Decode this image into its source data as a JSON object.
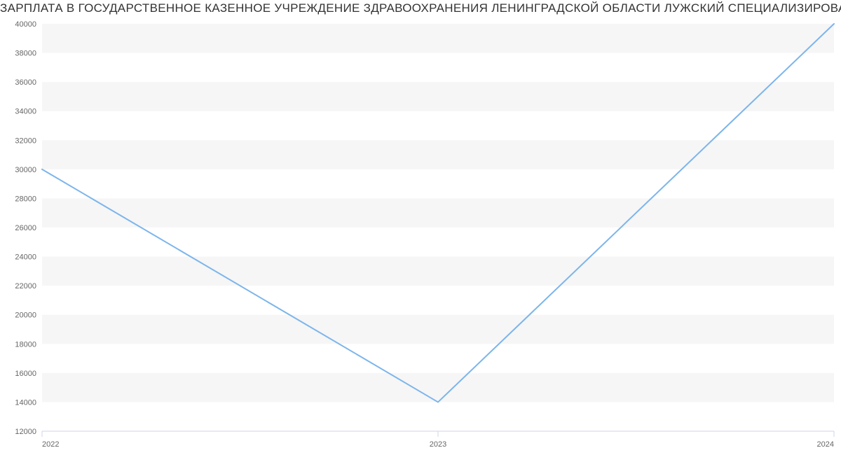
{
  "title": "ЗАРПЛАТА В ГОСУДАРСТВЕННОЕ КАЗЕННОЕ УЧРЕЖДЕНИЕ ЗДРАВООХРАНЕНИЯ ЛЕНИНГРАДСКОЙ ОБЛАСТИ  ЛУЖСКИЙ СПЕЦИАЛИЗИРОВАННЫЙ ДОМ РЕБЕНКА | Данные mnogodetey.ru",
  "chart_data": {
    "type": "line",
    "x": [
      2022,
      2023,
      2024
    ],
    "values": [
      30000,
      14000,
      40000
    ],
    "xlabel": "",
    "ylabel": "",
    "xlim": [
      2022,
      2024
    ],
    "ylim": [
      12000,
      40000
    ],
    "x_ticks": [
      "2022",
      "2023",
      "2024"
    ],
    "y_ticks": [
      "12000",
      "14000",
      "16000",
      "18000",
      "20000",
      "22000",
      "24000",
      "26000",
      "28000",
      "30000",
      "32000",
      "34000",
      "36000",
      "38000",
      "40000"
    ],
    "series_color": "#7cb5ec"
  }
}
